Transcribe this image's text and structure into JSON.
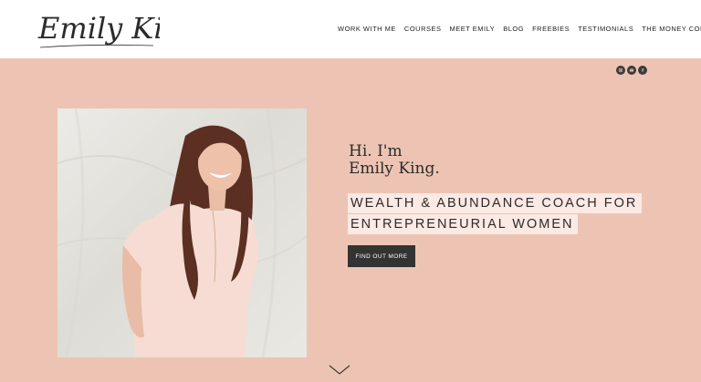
{
  "brand": {
    "logo_text": "Emily King"
  },
  "nav": {
    "items": [
      {
        "label": "WORK WITH ME",
        "name": "nav-item-work-with-me"
      },
      {
        "label": "COURSES",
        "name": "nav-item-courses"
      },
      {
        "label": "MEET EMILY",
        "name": "nav-item-meet-emily"
      },
      {
        "label": "BLOG",
        "name": "nav-item-blog"
      },
      {
        "label": "FREEBIES",
        "name": "nav-item-freebies"
      },
      {
        "label": "TESTIMONIALS",
        "name": "nav-item-testimonials"
      },
      {
        "label": "THE MONEY CODE",
        "name": "nav-item-the-money-code"
      }
    ]
  },
  "social": {
    "icons": [
      "instagram-icon",
      "email-icon",
      "facebook-icon"
    ]
  },
  "hero": {
    "greeting_line1": "Hi. I'm",
    "greeting_line2": "Emily King.",
    "tagline_line1": "WEALTH & ABUNDANCE COACH FOR",
    "tagline_line2": "ENTREPRENEURIAL WOMEN",
    "cta_label": "FIND OUT MORE"
  },
  "colors": {
    "background": "#edc4b3",
    "header": "#ffffff",
    "highlight": "#fbe9e3",
    "button": "#333333",
    "text": "#2b2b2b"
  }
}
